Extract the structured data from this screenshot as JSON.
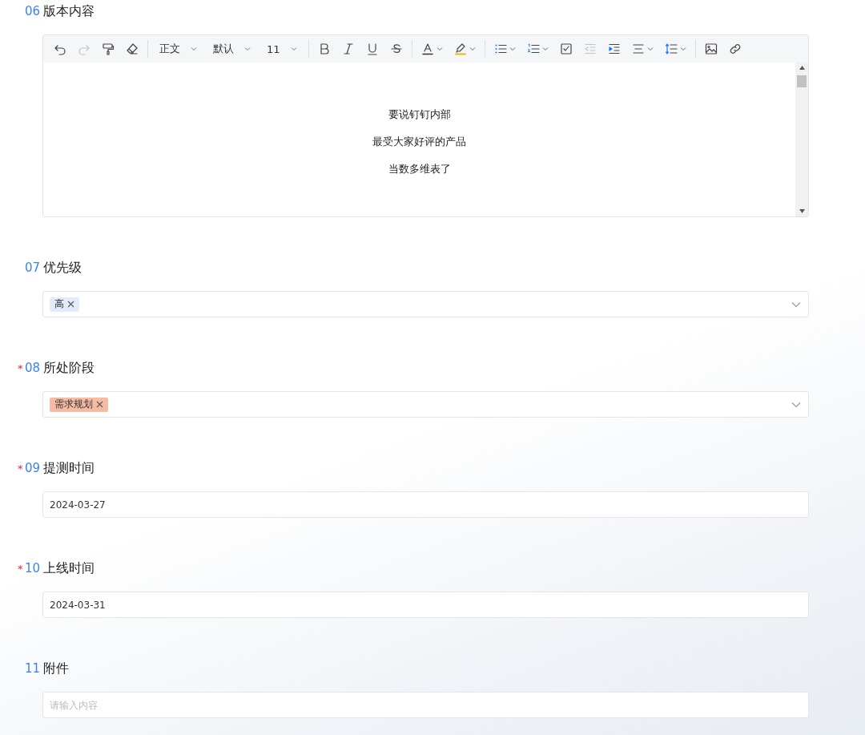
{
  "fields": [
    {
      "number": "06",
      "label": "版本内容",
      "kind": "editor",
      "toolbar": [
        {
          "kind": "undo",
          "disabled": false
        },
        {
          "kind": "redo",
          "disabled": true
        },
        {
          "kind": "painter",
          "disabled": false
        },
        {
          "kind": "eraser",
          "disabled": false
        },
        {
          "kind": "divider"
        },
        {
          "kind": "select",
          "value": "正文"
        },
        {
          "kind": "select",
          "value": "默认"
        },
        {
          "kind": "select",
          "value": "11"
        },
        {
          "kind": "divider"
        },
        {
          "kind": "bold",
          "disabled": false
        },
        {
          "kind": "italic",
          "disabled": false
        },
        {
          "kind": "underline",
          "disabled": false
        },
        {
          "kind": "strike",
          "disabled": false
        },
        {
          "kind": "divider"
        },
        {
          "kind": "font-color",
          "disabled": false
        },
        {
          "kind": "highlight",
          "disabled": false
        },
        {
          "kind": "divider"
        },
        {
          "kind": "bullet-list",
          "disabled": false
        },
        {
          "kind": "numbered-list",
          "disabled": false
        },
        {
          "kind": "task",
          "disabled": false
        },
        {
          "kind": "outdent",
          "disabled": true
        },
        {
          "kind": "indent",
          "disabled": false
        },
        {
          "kind": "align",
          "disabled": false
        },
        {
          "kind": "line-height",
          "disabled": false
        },
        {
          "kind": "divider"
        },
        {
          "kind": "image",
          "disabled": false
        },
        {
          "kind": "link",
          "disabled": false
        }
      ],
      "paragraphs": [
        "要说钉钉内部",
        "最受大家好评的产品",
        "当数多维表了"
      ]
    },
    {
      "number": "07",
      "label": "优先级",
      "kind": "select",
      "tags": [
        {
          "text": "高",
          "color": "#e3ecfb"
        }
      ]
    },
    {
      "number": "08",
      "label": "所处阶段",
      "required_mark": "*",
      "kind": "select",
      "tags": [
        {
          "text": "需求规划",
          "color": "#f7bba4"
        }
      ]
    },
    {
      "number": "09",
      "label": "提测时间",
      "required_mark": "*",
      "kind": "input",
      "value": "2024-03-27"
    },
    {
      "number": "10",
      "label": "上线时间",
      "required_mark": "*",
      "kind": "input",
      "value": "2024-03-31"
    },
    {
      "number": "11",
      "label": "附件",
      "kind": "input",
      "placeholder": "请输入内容"
    }
  ]
}
